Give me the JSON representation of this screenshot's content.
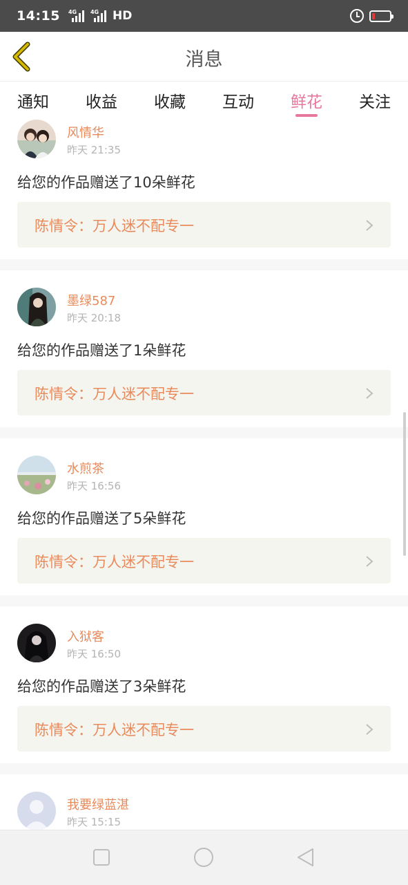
{
  "status_bar": {
    "time": "14:15",
    "network_1": "4G",
    "network_2": "4G",
    "hd": "HD",
    "battery_level_percent": 15,
    "battery_color": "#e53935",
    "icons": [
      "alarm-icon",
      "battery-icon"
    ]
  },
  "header": {
    "title": "消息",
    "back_icon": "chevron-left-icon",
    "back_icon_color": "#d6b800"
  },
  "tabs": {
    "items": [
      "通知",
      "收益",
      "收藏",
      "互动",
      "鲜花",
      "关注"
    ],
    "active_index": 4,
    "active_color": "#e8779e"
  },
  "messages": [
    {
      "user": "风情华",
      "time": "昨天 21:35",
      "text": "给您的作品赠送了10朵鲜花",
      "work_title": "陈情令：万人迷不配专一",
      "avatar_icon": "user-avatar-icon"
    },
    {
      "user": "墨绿587",
      "time": "昨天 20:18",
      "text": "给您的作品赠送了1朵鲜花",
      "work_title": "陈情令：万人迷不配专一",
      "avatar_icon": "user-avatar-icon"
    },
    {
      "user": "水煎茶",
      "time": "昨天 16:56",
      "text": "给您的作品赠送了5朵鲜花",
      "work_title": "陈情令：万人迷不配专一",
      "avatar_icon": "user-avatar-icon"
    },
    {
      "user": "入狱客",
      "time": "昨天 16:50",
      "text": "给您的作品赠送了3朵鲜花",
      "work_title": "陈情令：万人迷不配专一",
      "avatar_icon": "user-avatar-icon"
    },
    {
      "user": "我要绿蓝湛",
      "time": "昨天 15:15",
      "avatar_icon": "default-avatar-icon"
    }
  ],
  "colors": {
    "username": "#e98a5b",
    "work_card_bg": "#f5f5ef",
    "timestamp": "#b4b4b4"
  },
  "nav_bar": {
    "icons": [
      "recent-apps-icon",
      "home-icon",
      "back-triangle-icon"
    ]
  }
}
